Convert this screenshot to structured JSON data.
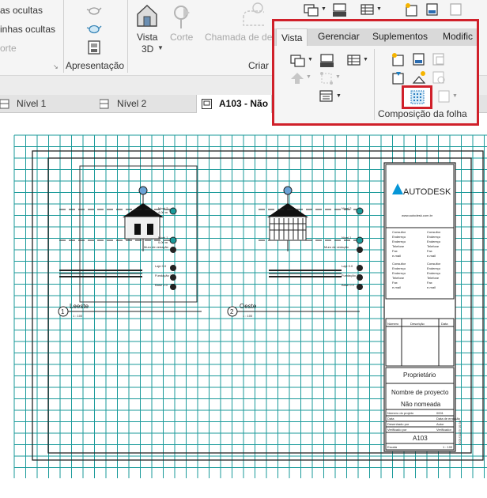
{
  "ribbon": {
    "col1": [
      "as ocultas",
      "inhas ocultas",
      "orte"
    ],
    "apresentacao_label": "Apresentação",
    "vista3d_label": "Vista",
    "vista3d_sub": "3D",
    "corte_label": "Corte",
    "chamada_label": "Chamada de de",
    "criar_label": "Criar"
  },
  "tabs": [
    {
      "label": "Nível 1"
    },
    {
      "label": "Nível 2"
    },
    {
      "label": "A103 - Não"
    }
  ],
  "popup": {
    "tabs": [
      "Vista",
      "Gerenciar",
      "Suplementos",
      "Modific"
    ],
    "group_label": "Composição da folha"
  },
  "sheet": {
    "views": [
      {
        "number": "1",
        "name": "Leeste",
        "scale": "1 : 100"
      },
      {
        "number": "2",
        "name": "Oeste",
        "scale": "1 : 100"
      }
    ],
    "levels": [
      "Nível 2",
      "Nível 1",
      "Muro de vedação",
      "Laje 0.0",
      "Fundação 1",
      "Base 0.0"
    ],
    "level_values": [
      "4,00 m",
      "0,00 m",
      "-1,00 m",
      "-2,00 m",
      "-3,00 m",
      "-4,00 m"
    ],
    "titleblock": {
      "brand": "AUTODESK",
      "website": "www.autodesk.com.br",
      "consultants_left": [
        "Consultor",
        "Endereço",
        "Endereço",
        "Telefone",
        "Fax",
        "e-mail"
      ],
      "consultants_right": [
        "Consultor",
        "Endereço",
        "Endereço",
        "Telefone",
        "Fax",
        "e-mail"
      ],
      "rev_headers": [
        "Número",
        "Descrição",
        "Data"
      ],
      "owner": "Proprietário",
      "project": "Nombre de proyecto",
      "sheet_name": "Não nomeada",
      "rows": [
        {
          "left": "Número do projeto",
          "right": "0001"
        },
        {
          "left": "Data",
          "right": "Data de emissão"
        },
        {
          "left": "Desenhado por",
          "right": "Autor"
        },
        {
          "left": "Verificado por",
          "right": "Verificador"
        }
      ],
      "sheet_number": "A103",
      "scale_label": "Escala",
      "scale_value": "1 : 100",
      "side_text": "2021/11/23 10:38"
    }
  },
  "colors": {
    "highlight": "#d0202a",
    "grid": "#1a9a9a",
    "brand_blue": "#0696d7"
  }
}
